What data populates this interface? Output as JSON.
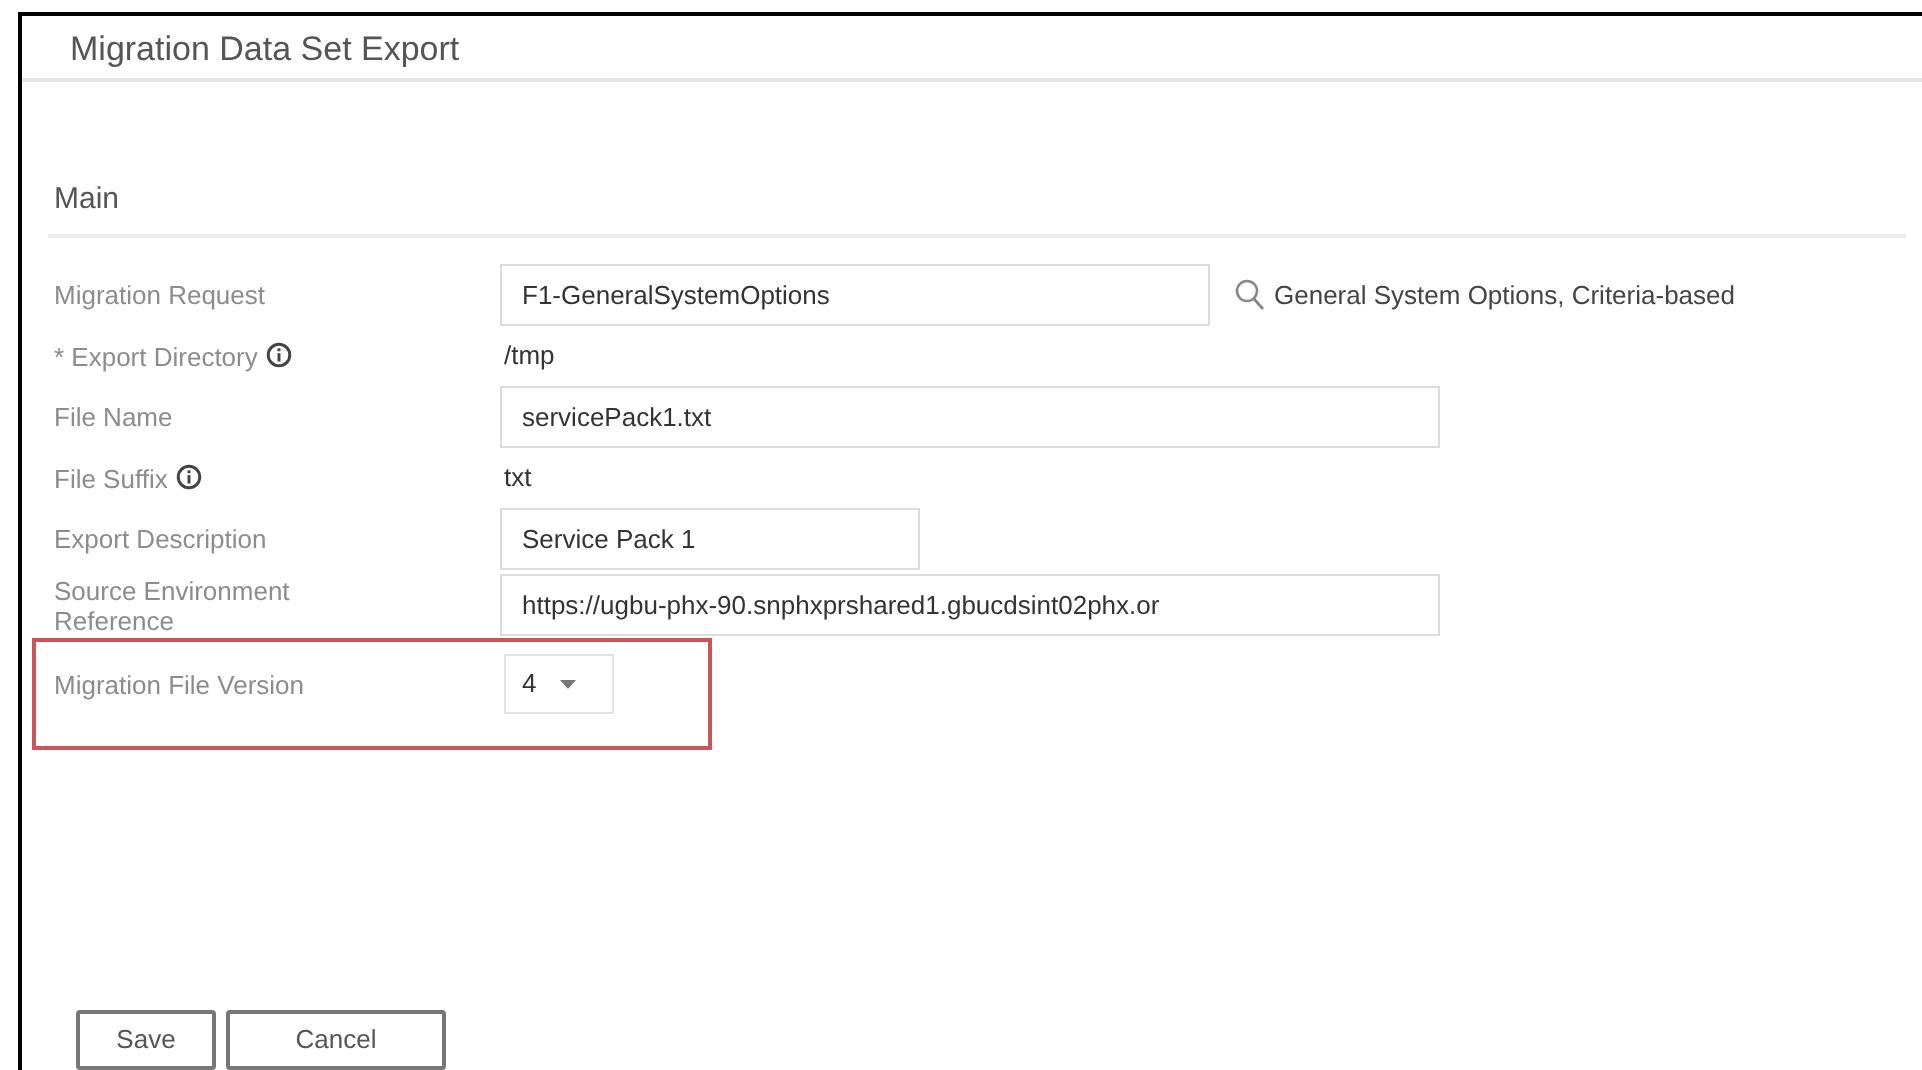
{
  "window": {
    "title": "Migration Data Set Export"
  },
  "section": {
    "title": "Main"
  },
  "fields": [
    {
      "kind": "lookup",
      "label": "Migration Request",
      "info": false,
      "highlighted": false,
      "value": "F1-GeneralSystemOptions",
      "description": "General System Options, Criteria-based"
    },
    {
      "kind": "text",
      "label": "* Export Directory",
      "info": true,
      "highlighted": false,
      "value": "/tmp"
    },
    {
      "kind": "input",
      "label": "File Name",
      "info": false,
      "highlighted": false,
      "value": "servicePack1.txt"
    },
    {
      "kind": "text",
      "label": "File Suffix",
      "info": true,
      "highlighted": false,
      "value": "txt"
    },
    {
      "kind": "shortinput",
      "label": "Export Description",
      "info": false,
      "highlighted": false,
      "value": "Service Pack 1"
    },
    {
      "kind": "input",
      "label": "Source Environment Reference",
      "info": false,
      "highlighted": false,
      "value": "https://ugbu-phx-90.snphxprshared1.gbucdsint02phx.or"
    },
    {
      "kind": "select",
      "label": "Migration File Version",
      "info": false,
      "highlighted": true,
      "value": "4"
    }
  ],
  "buttons": [
    "Save",
    "Cancel"
  ]
}
